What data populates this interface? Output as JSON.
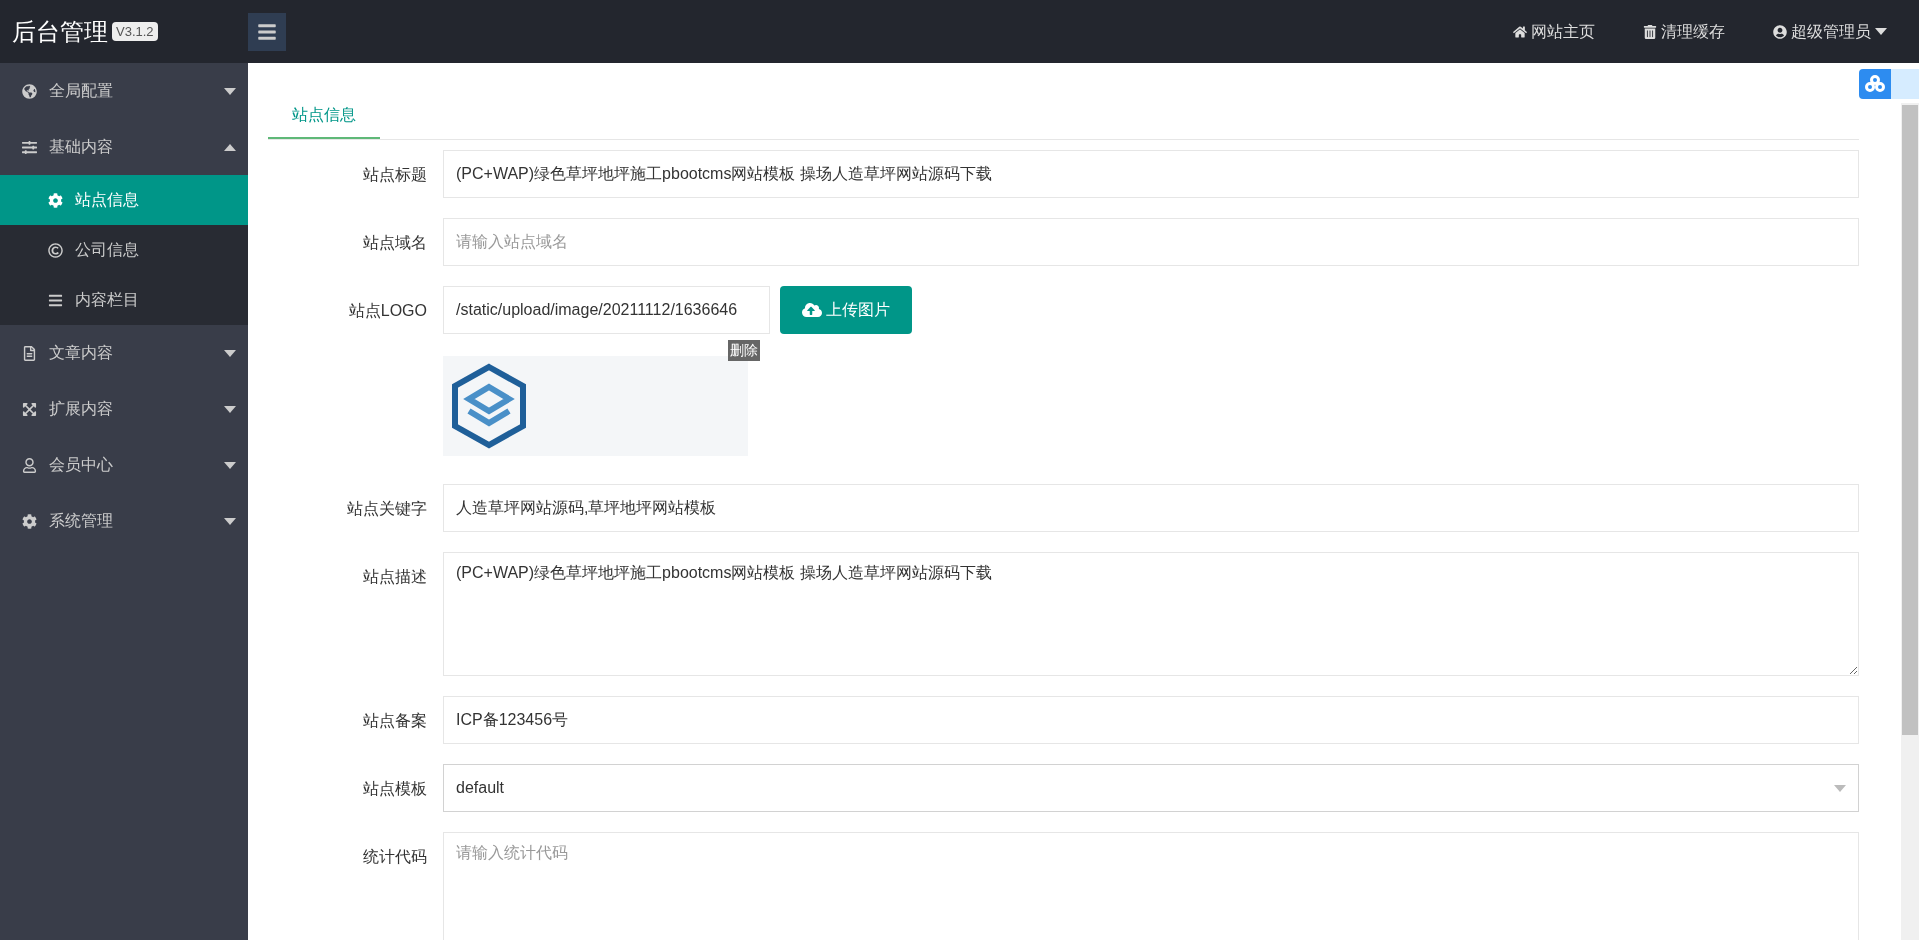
{
  "brand": {
    "title": "后台管理",
    "version": "V3.1.2"
  },
  "topbar": {
    "links": [
      {
        "kind": "home",
        "label": "网站主页"
      },
      {
        "kind": "trash",
        "label": "清理缓存"
      },
      {
        "kind": "user",
        "label": "超级管理员"
      }
    ]
  },
  "sidebar": {
    "items": [
      {
        "kind": "globe",
        "label": "全局配置",
        "expanded": false
      },
      {
        "kind": "sliders",
        "label": "基础内容",
        "expanded": true,
        "children": [
          {
            "kind": "gear",
            "label": "站点信息",
            "selected": true
          },
          {
            "kind": "copyright",
            "label": "公司信息",
            "selected": false
          },
          {
            "kind": "list",
            "label": "内容栏目",
            "selected": false
          }
        ]
      },
      {
        "kind": "file",
        "label": "文章内容",
        "expanded": false
      },
      {
        "kind": "expand",
        "label": "扩展内容",
        "expanded": false
      },
      {
        "kind": "user",
        "label": "会员中心",
        "expanded": false
      },
      {
        "kind": "gear",
        "label": "系统管理",
        "expanded": false
      }
    ]
  },
  "tabs": [
    {
      "label": "站点信息",
      "selected": true
    }
  ],
  "form": {
    "fields": [
      {
        "kind": "text",
        "label": "站点标题",
        "value": "(PC+WAP)绿色草坪地坪施工pbootcms网站模板 操场人造草坪网站源码下载"
      },
      {
        "kind": "text",
        "label": "站点域名",
        "placeholder": "请输入站点域名"
      },
      {
        "kind": "upload",
        "label": "站点LOGO",
        "value": "/static/upload/image/20211112/1636646",
        "button": "上传图片",
        "delete": "删除"
      },
      {
        "kind": "text",
        "label": "站点关键字",
        "value": "人造草坪网站源码,草坪地坪网站模板"
      },
      {
        "kind": "textarea",
        "label": "站点描述",
        "value": "(PC+WAP)绿色草坪地坪施工pbootcms网站模板 操场人造草坪网站源码下载"
      },
      {
        "kind": "text",
        "label": "站点备案",
        "value": "ICP备123456号"
      },
      {
        "kind": "select",
        "label": "站点模板",
        "value": "default"
      },
      {
        "kind": "textarea",
        "label": "统计代码",
        "placeholder": "请输入统计代码"
      }
    ]
  }
}
